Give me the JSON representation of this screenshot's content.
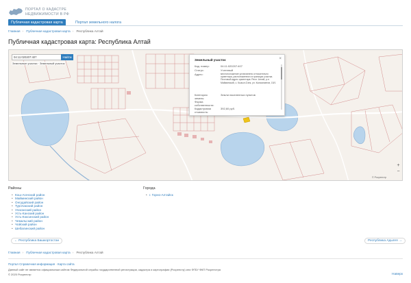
{
  "header": {
    "logo_line1": "ПОРТАЛ О КАДАСТРЕ",
    "logo_line2": "НЕДВИЖИМОСТИ В РФ"
  },
  "tabs": [
    {
      "label": "Публичная кадастровая карта",
      "active": true
    },
    {
      "label": "Портал земельного налога",
      "active": false
    }
  ],
  "breadcrumbs": {
    "items": [
      "Главная",
      "Публичная кадастровая карта",
      "Республика Алтай"
    ]
  },
  "page_title": "Публичная кадастровая карта: Республика Алтай",
  "map": {
    "search_value": "04:11:020207:407",
    "search_button": "Найти",
    "layer_label": "Земельные участки · Земельный участок",
    "zoom_in": "+",
    "zoom_out": "−",
    "attribution": "© Росреестр"
  },
  "popup": {
    "title": "Земельный участок",
    "rows": [
      {
        "key": "Кад. номер:",
        "value": "04:11:020207:407"
      },
      {
        "key": "Статус:",
        "value": "Учтенный"
      },
      {
        "key": "Адрес:",
        "value": "местоположение установлено относительно ориентира, расположенного в границах участка. Почтовый адрес ориентира: Респ. Алтай, р-н Майминский, с. Кызыл-Озек, ул. Космонавтов, 15/1"
      },
      {
        "key": "Категория земель:",
        "value": "Земли населенных пунктов"
      },
      {
        "key": "Форма собственности:",
        "value": ""
      },
      {
        "key": "Кадастровая стоимость:",
        "value": "392,60 руб."
      }
    ]
  },
  "regions": {
    "heading": "Районы",
    "items": [
      "Кош-Агачский район",
      "Майминский район",
      "Онгудайский район",
      "Турочакский район",
      "Улаганский район",
      "Усть-Канский район",
      "Усть-Коксинский район",
      "Чемальский район",
      "Чойский район",
      "Шебалинский район"
    ]
  },
  "cities": {
    "heading": "Города",
    "items": [
      "г. Горно-Алтайск"
    ]
  },
  "pager": {
    "prev": "← Республика Башкортостан",
    "next": "Республика Адыгея →"
  },
  "footer": {
    "line1_prefix": "Портал ",
    "line1_link1": "Справочная информация",
    "line1_sep": " · ",
    "line1_link2": "Карта сайта",
    "line2": "Данный сайт не является официальным сайтом Федеральной службы государственной регистрации, кадастра и картографии (Росреестр) или ФГБУ ФКП Росреестра",
    "line3": "© 2020 Росреестр",
    "help": "Наверх"
  },
  "colors": {
    "accent": "#2f7dbd",
    "water": "#b8d4ec",
    "parcel_line": "#d48b8b",
    "popup_marker": "#f0c419"
  }
}
